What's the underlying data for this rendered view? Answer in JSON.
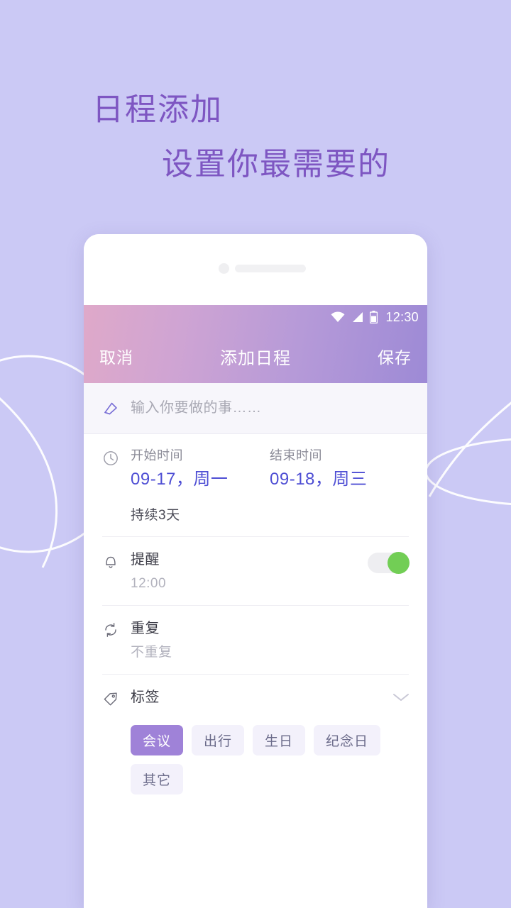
{
  "promo": {
    "line1": "日程添加",
    "line2": "设置你最需要的",
    "color": "#7e56c2"
  },
  "background": {
    "color": "#cbc9f5",
    "curve_color": "#ffffff"
  },
  "phone": {
    "statusbar": {
      "time": "12:30",
      "icons": [
        "wifi-icon",
        "signal-icon",
        "battery-icon"
      ]
    },
    "appbar": {
      "cancel_label": "取消",
      "title": "添加日程",
      "save_label": "保存",
      "gradient_from": "#dfa9c9",
      "gradient_to": "#9d8ad6"
    },
    "title_field": {
      "icon": "pencil-icon",
      "value": "",
      "placeholder": "输入你要做的事……"
    },
    "time_section": {
      "icon": "clock-icon",
      "start_label": "开始时间",
      "start_value": "09-17，周一",
      "end_label": "结束时间",
      "end_value": "09-18，周三",
      "duration": "持续3天",
      "value_color": "#4e4ed4"
    },
    "reminder_section": {
      "icon": "bell-icon",
      "title": "提醒",
      "value": "12:00",
      "toggle_on": true,
      "toggle_color": "#72ce55"
    },
    "repeat_section": {
      "icon": "repeat-icon",
      "title": "重复",
      "value": "不重复"
    },
    "tag_section": {
      "icon": "tag-icon",
      "title": "标签",
      "expand_icon": "chevron-down-icon",
      "tags": [
        {
          "label": "会议",
          "selected": true
        },
        {
          "label": "出行",
          "selected": false
        },
        {
          "label": "生日",
          "selected": false
        },
        {
          "label": "纪念日",
          "selected": false
        },
        {
          "label": "其它",
          "selected": false
        }
      ],
      "selected_color": "#9f82d8"
    }
  }
}
